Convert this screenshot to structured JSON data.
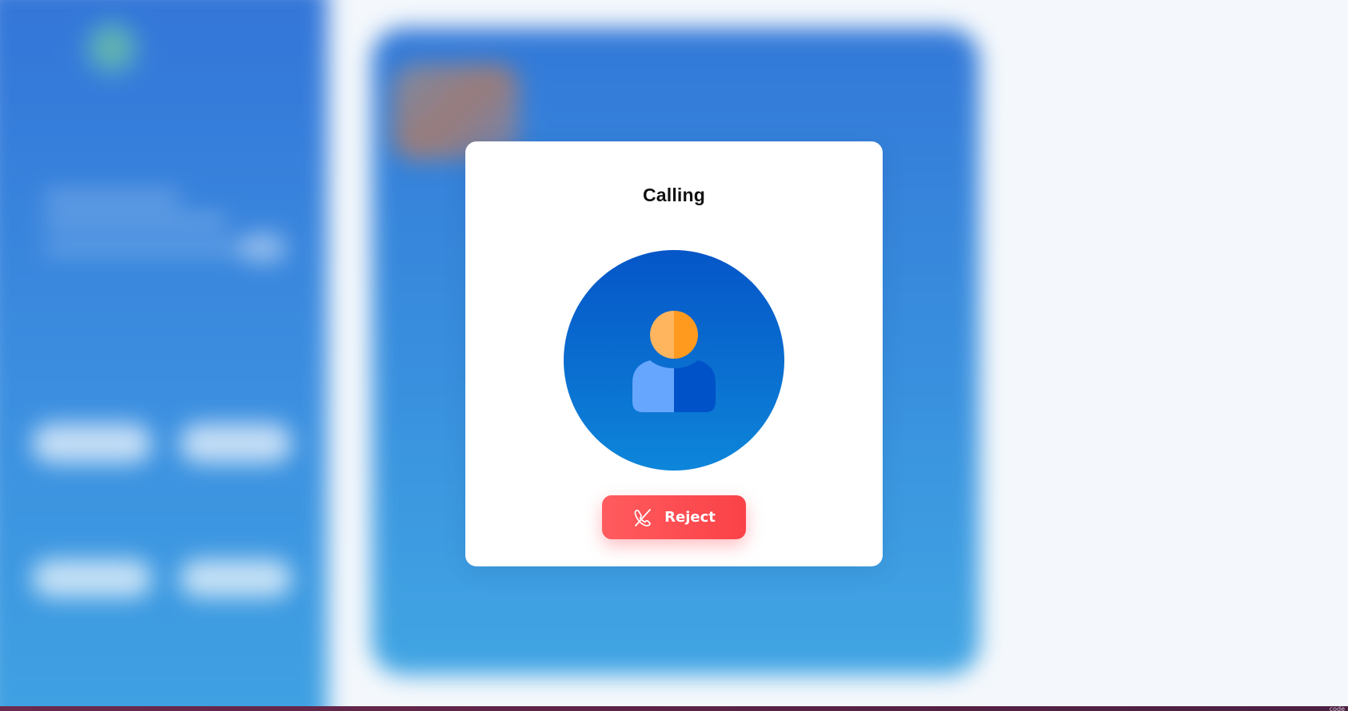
{
  "call_dialog": {
    "title": "Calling",
    "reject_label": "Reject",
    "avatar_icon": "user-icon",
    "reject_icon": "phone-hangup-icon"
  },
  "taskbar": {
    "text": "code"
  },
  "colors": {
    "reject_button": "#ff4a50",
    "avatar_background": "#0a6fd0",
    "avatar_head": "#ff9a2a",
    "avatar_body": "#0052c8",
    "backdrop_blue": "#3a8ee0"
  }
}
